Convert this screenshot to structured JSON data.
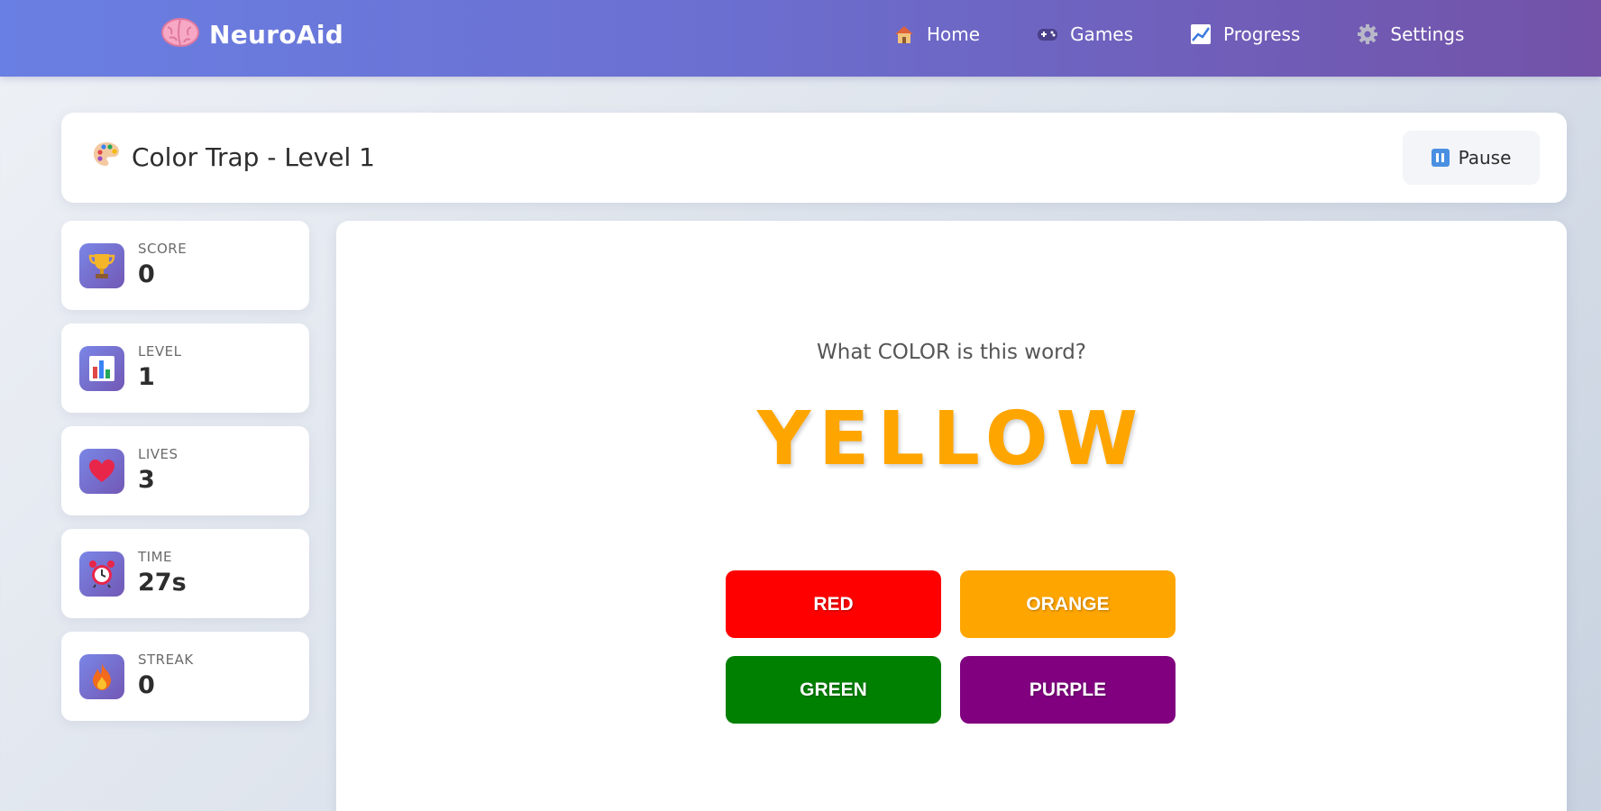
{
  "nav": {
    "brand": "NeuroAid",
    "links": [
      {
        "label": "Home",
        "icon": "house-icon"
      },
      {
        "label": "Games",
        "icon": "gamepad-icon"
      },
      {
        "label": "Progress",
        "icon": "chart-icon"
      },
      {
        "label": "Settings",
        "icon": "gear-icon"
      }
    ]
  },
  "header": {
    "title": "Color Trap - Level 1",
    "pause_label": "Pause"
  },
  "stats": [
    {
      "label": "SCORE",
      "value": "0",
      "icon": "trophy-icon"
    },
    {
      "label": "LEVEL",
      "value": "1",
      "icon": "bar-chart-icon"
    },
    {
      "label": "LIVES",
      "value": "3",
      "icon": "heart-icon"
    },
    {
      "label": "TIME",
      "value": "27s",
      "icon": "alarm-clock-icon"
    },
    {
      "label": "STREAK",
      "value": "0",
      "icon": "fire-icon"
    }
  ],
  "game": {
    "prompt": "What COLOR is this word?",
    "word": "YELLOW",
    "word_color": "#ffa500",
    "options": [
      {
        "label": "RED",
        "color": "#ff0000"
      },
      {
        "label": "ORANGE",
        "color": "#ffa500"
      },
      {
        "label": "GREEN",
        "color": "#008000"
      },
      {
        "label": "PURPLE",
        "color": "#800080"
      }
    ]
  }
}
